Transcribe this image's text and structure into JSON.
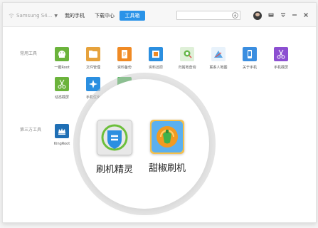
{
  "header": {
    "device_name": "Samsung S4...",
    "tabs": [
      {
        "label": "我的手机",
        "active": false
      },
      {
        "label": "下载中心",
        "active": false
      },
      {
        "label": "工具箱",
        "active": true
      }
    ],
    "search": {
      "placeholder": "",
      "value": ""
    },
    "accent_color": "#2a93e8"
  },
  "sections": {
    "common_label": "常用工具",
    "third_party_label": "第三方工具"
  },
  "common_tools": [
    {
      "label": "一键Root",
      "icon": "android-root-icon",
      "color": "#6bb33b"
    },
    {
      "label": "文件管理",
      "icon": "folder-icon",
      "color": "#e6a23c"
    },
    {
      "label": "资料备份",
      "icon": "backup-icon",
      "color": "#f08a24"
    },
    {
      "label": "资料还原",
      "icon": "restore-icon",
      "color": "#2b8fe0"
    },
    {
      "label": "归属地查询",
      "icon": "location-icon",
      "color": "#66b84a"
    },
    {
      "label": "联系人地图",
      "icon": "contacts-map-icon",
      "color": "#5aa6e6"
    },
    {
      "label": "关于手机",
      "icon": "phone-icon",
      "color": "#3b8ee0"
    },
    {
      "label": "手机截屏",
      "icon": "scissors-icon",
      "color": "#8c4fd1"
    },
    {
      "label": "动态截屏",
      "icon": "scissors-icon",
      "color": "#6bb33b"
    },
    {
      "label": "手机优化",
      "icon": "optimize-icon",
      "color": "#2b8fe0"
    }
  ],
  "third_party_tools": [
    {
      "label": "KingRoot",
      "icon": "kingroot-icon",
      "color": "#1f6fb5"
    }
  ],
  "magnified_tools": [
    {
      "label": "刷机精灵",
      "icon": "shuaji-jingling-icon",
      "color": "#2b8fe0"
    },
    {
      "label": "甜椒刷机",
      "icon": "tianjiao-shuaji-icon",
      "color": "#f29a1f"
    }
  ]
}
